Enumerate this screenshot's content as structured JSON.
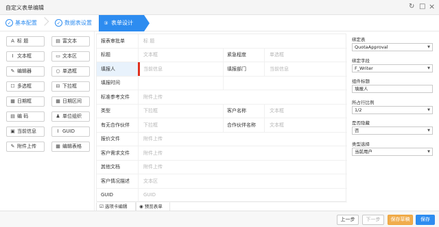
{
  "window": {
    "title": "自定义表单编辑",
    "refresh_glyph": "↻",
    "maximize_glyph": "□",
    "close_glyph": "×"
  },
  "steps": [
    {
      "num": "✓",
      "label": "基本配置",
      "state": "done"
    },
    {
      "num": "✓",
      "label": "数据表设置",
      "state": "done"
    },
    {
      "num": "③",
      "label": "表单设计",
      "state": "active"
    }
  ],
  "toolbox": [
    {
      "icon": "A",
      "label": "标 题"
    },
    {
      "icon": "▤",
      "label": "富文本"
    },
    {
      "icon": "I",
      "label": "文本框"
    },
    {
      "icon": "▭",
      "label": "文本区"
    },
    {
      "icon": "✎",
      "label": "编辑器"
    },
    {
      "icon": "○",
      "label": "单选框"
    },
    {
      "icon": "☐",
      "label": "多选框"
    },
    {
      "icon": "⊟",
      "label": "下拉框"
    },
    {
      "icon": "▦",
      "label": "日期框"
    },
    {
      "icon": "▦",
      "label": "日期区间"
    },
    {
      "icon": "▤",
      "label": "编 码"
    },
    {
      "icon": "♟",
      "label": "单位组织"
    },
    {
      "icon": "▣",
      "label": "当前信息"
    },
    {
      "icon": "I",
      "label": "GUID"
    },
    {
      "icon": "✎",
      "label": "附件上传"
    },
    {
      "icon": "▦",
      "label": "编辑表格"
    }
  ],
  "form": {
    "rows": [
      {
        "label": "报表审批单",
        "value": "标 题"
      },
      {
        "label": "标题",
        "value": "文本框",
        "label2": "紧急程度",
        "value2": "单选框"
      },
      {
        "label": "填报人",
        "value": "当前信息",
        "label2": "填报部门",
        "value2": "当前信息",
        "selected": true
      },
      {
        "label": "填报时间",
        "value": ""
      },
      {
        "label": "标准参考文件",
        "value": "附件上传"
      },
      {
        "label": "类型",
        "value": "下拉框",
        "label2": "客户名称",
        "value2": "文本框"
      },
      {
        "label": "有无合作伙伴",
        "value": "下拉框",
        "label2": "合作伙伴名称",
        "value2": "文本框"
      },
      {
        "label": "报价文件",
        "value": "附件上传"
      },
      {
        "label": "客户需求文件",
        "value": "附件上传"
      },
      {
        "label": "其他文档",
        "value": "附件上传"
      },
      {
        "label": "客户情况描述",
        "value": "文本区"
      },
      {
        "label": "GUID",
        "value": "GUID"
      }
    ]
  },
  "bottom_tabs": [
    {
      "icon": "☑",
      "label": "选项卡编辑"
    },
    {
      "icon": "◉",
      "label": "预览表单"
    }
  ],
  "properties": [
    {
      "label": "绑定表",
      "value": "QuotaApproval"
    },
    {
      "label": "绑定字段",
      "value": "F_Writer"
    },
    {
      "label": "组件标题",
      "value": "填报人",
      "plain": true
    },
    {
      "label": "所占行比例",
      "value": "1/2"
    },
    {
      "label": "是否隐藏",
      "value": "否"
    },
    {
      "label": "类型选择",
      "value": "当前用户"
    }
  ],
  "footer": {
    "prev": "上一步",
    "next": "下一步",
    "save_draft": "保存草稿",
    "save": "保存"
  },
  "colors": {
    "accent": "#2d8cf0",
    "warn": "#f0ad4e",
    "marker": "#e0301e"
  }
}
